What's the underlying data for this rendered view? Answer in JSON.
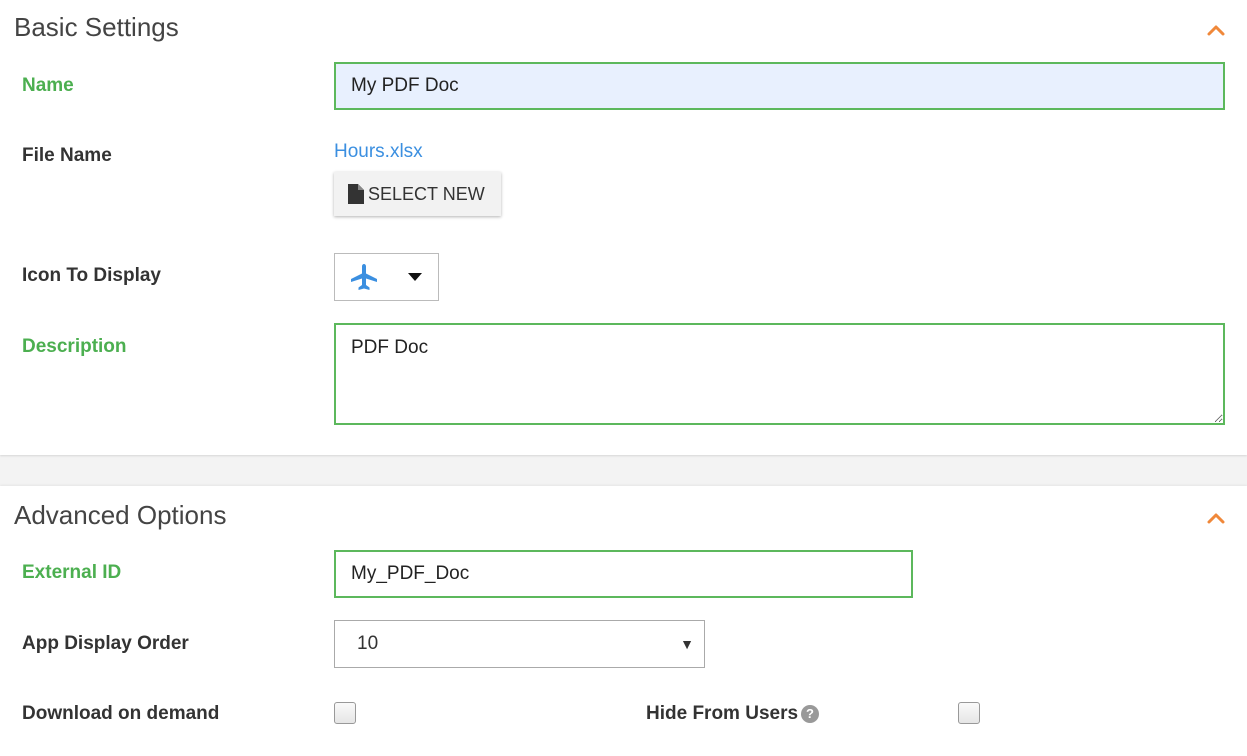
{
  "basic_settings": {
    "title": "Basic Settings",
    "name_label": "Name",
    "name_value": "My PDF Doc",
    "file_name_label": "File Name",
    "file_name_value": "Hours.xlsx",
    "select_new_label": "SELECT NEW",
    "icon_label": "Icon To Display",
    "icon_selected": "airplane-icon",
    "description_label": "Description",
    "description_value": "PDF Doc"
  },
  "advanced_options": {
    "title": "Advanced Options",
    "external_id_label": "External ID",
    "external_id_value": "My_PDF_Doc",
    "display_order_label": "App Display Order",
    "display_order_value": "10",
    "download_label": "Download on demand",
    "download_checked": false,
    "hide_label": "Hide From Users",
    "hide_checked": false,
    "help_glyph": "?"
  },
  "colors": {
    "accent_orange": "#f0883a",
    "valid_green": "#5cb85c",
    "link_blue": "#3b8fe0",
    "autofill_bg": "#e8f0fe"
  }
}
